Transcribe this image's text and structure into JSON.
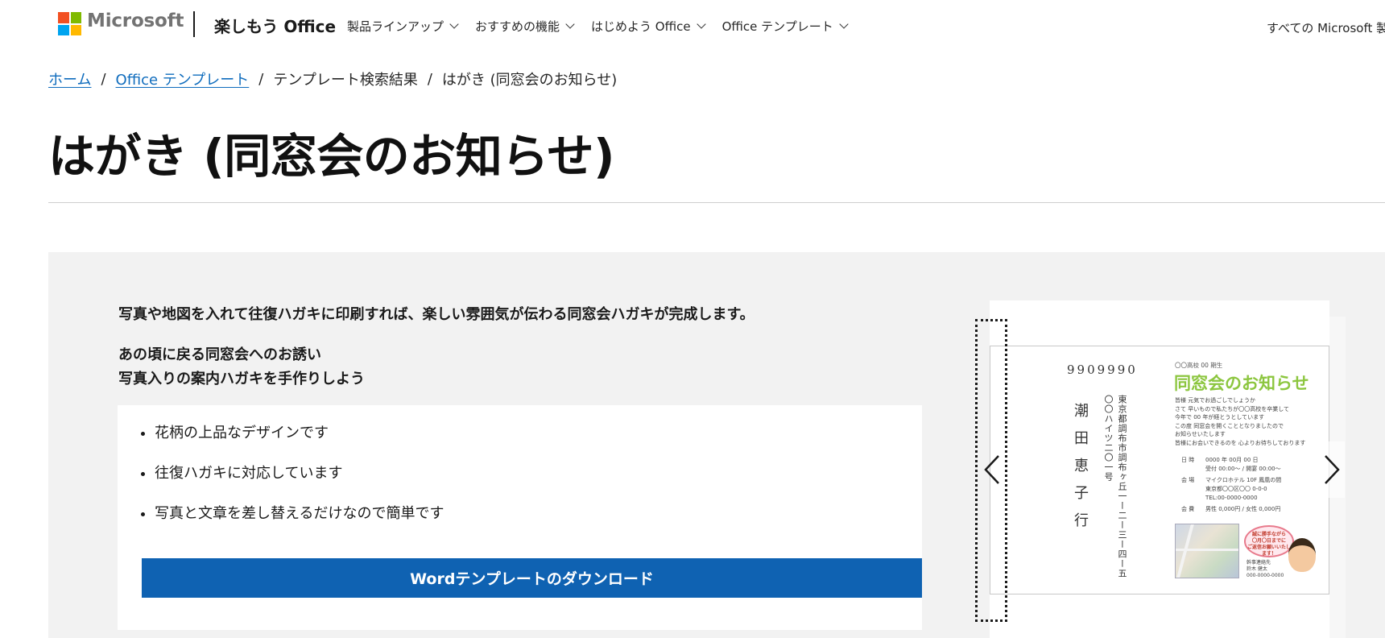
{
  "header": {
    "brand": "Microsoft",
    "site_title": "楽しもう Office",
    "nav": [
      {
        "label": "製品ラインアップ"
      },
      {
        "label": "おすすめの機能"
      },
      {
        "label": "はじめよう Office"
      },
      {
        "label": "Office テンプレート"
      }
    ],
    "all_microsoft": "すべての Microsoft 製",
    "colors": {
      "red": "#f25022",
      "green": "#7fba00",
      "blue": "#00a4ef",
      "yellow": "#ffb900"
    }
  },
  "breadcrumb": {
    "home": "ホーム",
    "templates": "Office テンプレート",
    "search_results": "テンプレート検索結果",
    "current": "はがき (同窓会のお知らせ)",
    "separator": "/"
  },
  "page": {
    "title": "はがき (同窓会のお知らせ)",
    "intro": "写真や地図を入れて往復ハガキに印刷すれば、楽しい雰囲気が伝わる同窓会ハガキが完成します。",
    "sub_line1": "あの頃に戻る同窓会へのお誘い",
    "sub_line2": "写真入りの案内ハガキを手作りしよう"
  },
  "features": [
    "花柄の上品なデザインです",
    "往復ハガキに対応しています",
    "写真と文章を差し替えるだけなので簡単です"
  ],
  "download_button": "Wordテンプレートのダウンロード",
  "accent_color": "#0f62b2",
  "preview": {
    "zip": "9909990",
    "address_line1": "東京都調布市調布ヶ丘一ー二ー三ー四ー五",
    "address_line2": "〇〇ハイツ二〇一号",
    "recipient": "潮田恵子行",
    "class_line": "〇〇高校 00 期生",
    "heading": "同窓会のお知らせ",
    "body": [
      "皆様 元気でお過ごしでしょうか",
      "さて 早いもので私たちが〇〇高校を卒業して",
      "今年で 00 年が経とうとしています",
      "この度 同窓会を開くこととなりましたので",
      "お知らせいたします",
      "皆様にお会いできるのを 心よりお待ちしております"
    ],
    "details": [
      {
        "label": "日 時",
        "value": "0000 年 00月 00 日"
      },
      {
        "label": "",
        "value": "受付 00:00～ / 開宴 00:00～"
      },
      {
        "label": "会 場",
        "value": "マイクロホテル 10F 鳳凰の間"
      },
      {
        "label": "",
        "value": "東京都〇〇区〇〇 0-0-0"
      },
      {
        "label": "",
        "value": "TEL:00-0000-0000"
      },
      {
        "label": "会 費",
        "value": "男性 0,000円 / 女性 0,000円"
      }
    ],
    "bubble": [
      "誠に勝手ながら",
      "〇月〇日までに",
      "ご返信お願いいたし",
      "ます！"
    ],
    "contact": [
      "幹事連絡先",
      "鈴木 健太",
      "000-0000-0000"
    ],
    "heading_color": "#8cc63f"
  }
}
